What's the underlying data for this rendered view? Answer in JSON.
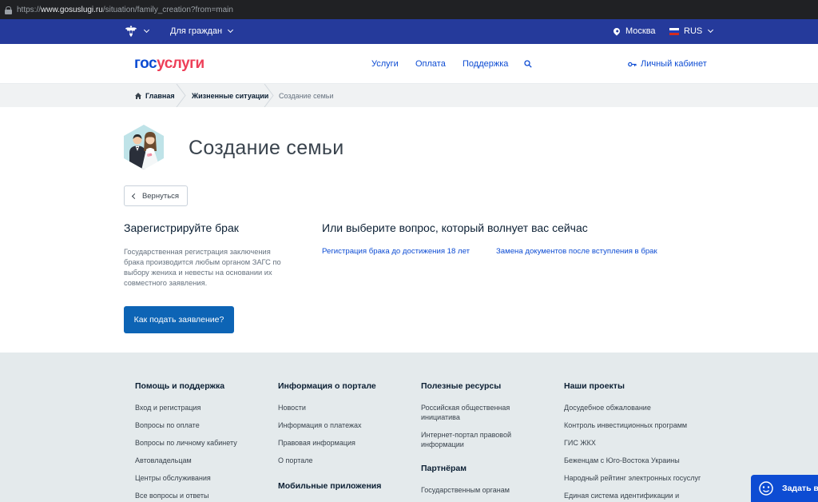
{
  "browser": {
    "url_prefix": "https://",
    "url_host": "www.gosuslugi.ru",
    "url_path": "/situation/family_creation?from=main"
  },
  "topbar": {
    "for_citizens": "Для граждан",
    "city": "Москва",
    "language": "RUS",
    "flag_colors": [
      "#ffffff",
      "#1c3fbf",
      "#d52b1e"
    ]
  },
  "header": {
    "logo_part1": "гос",
    "logo_part2": "услуги",
    "nav": [
      "Услуги",
      "Оплата",
      "Поддержка"
    ],
    "cabinet": "Личный кабинет"
  },
  "breadcrumbs": [
    "Главная",
    "Жизненные ситуации",
    "Создание семьи"
  ],
  "page": {
    "title": "Создание семьи",
    "back_button": "Вернуться",
    "left_title": "Зарегистрируйте брак",
    "left_text": "Государственная регистрация заключения брака производится любым органом ЗАГС по выбору жениха и невесты на основании их совместного заявления.",
    "apply_button": "Как подать заявление?",
    "right_title": "Или выберите вопрос, который волнует вас сейчас",
    "questions": [
      "Регистрация брака до достижения 18 лет",
      "Замена документов после вступления в брак"
    ]
  },
  "footer": {
    "col1": {
      "title": "Помощь и поддержка",
      "links": [
        "Вход и регистрация",
        "Вопросы по оплате",
        "Вопросы по личному кабинету",
        "Автовладельцам",
        "Центры обслуживания",
        "Все вопросы и ответы"
      ]
    },
    "col2": {
      "title": "Информация о портале",
      "links": [
        "Новости",
        "Информация о платежах",
        "Правовая информация",
        "О портале"
      ],
      "sub_title": "Мобильные приложения"
    },
    "col3": {
      "title": "Полезные ресурсы",
      "links": [
        "Российская общественная инициатива",
        "Интернет-портал правовой информации"
      ],
      "sub_title": "Партнёрам",
      "sub_links": [
        "Государственным органам"
      ]
    },
    "col4": {
      "title": "Наши проекты",
      "links": [
        "Досудебное обжалование",
        "Контроль инвестиционных программ",
        "ГИС ЖКХ",
        "Беженцам с Юго-Востока Украины",
        "Народный рейтинг электронных госуслуг",
        "Единая система идентификации и"
      ]
    }
  },
  "help_widget": {
    "label": "Задать вопрос"
  },
  "colors": {
    "topbar": "#253a9b",
    "link": "#0d4cd3",
    "button": "#0d64b5",
    "logo_red": "#ee3f58",
    "footer_bg": "#e4eaec"
  }
}
